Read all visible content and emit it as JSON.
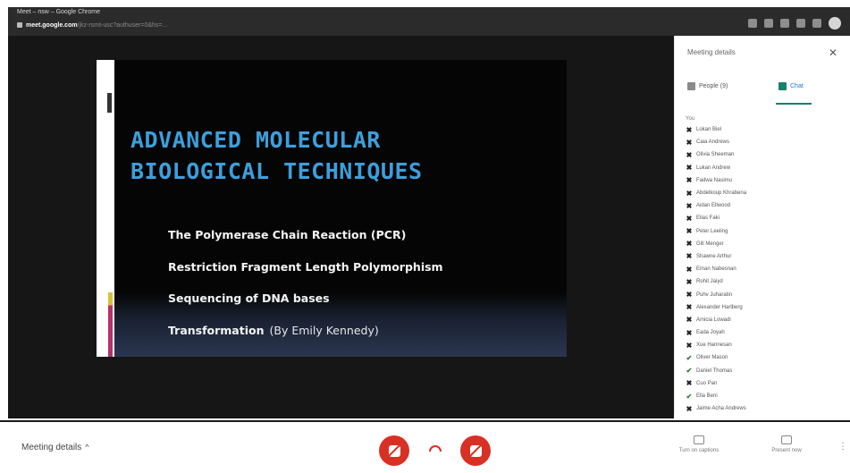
{
  "browser": {
    "title": "Meet – nsw – Google Chrome",
    "url_host": "meet.google.com",
    "url_path": "/jkz-rsmt-usc?authuser=0&hs=..."
  },
  "slide": {
    "title_line1": "ADVANCED MOLECULAR",
    "title_line2": "BIOLOGICAL TECHNIQUES",
    "bullets": [
      "The Polymerase Chain Reaction (PCR)",
      "Restriction Fragment Length Polymorphism",
      "Sequencing of DNA bases",
      "Transformation"
    ],
    "author": "(By Emily Kennedy)",
    "title_color": "#3d9fdc"
  },
  "panel": {
    "title": "Meeting details",
    "tabs": {
      "people": "People (9)",
      "chat": "Chat"
    },
    "sender": "You",
    "chat_messages": [
      {
        "mark": "x",
        "text": "Lokan Biel"
      },
      {
        "mark": "x",
        "text": "Caia Andrews"
      },
      {
        "mark": "x",
        "text": "Olivia Sheeman"
      },
      {
        "mark": "x",
        "text": "Lukan Andrew"
      },
      {
        "mark": "x",
        "text": "Fadwa Nasimu"
      },
      {
        "mark": "x",
        "text": "Abdelkoup Khrabena"
      },
      {
        "mark": "x",
        "text": "Aidan Ellwood"
      },
      {
        "mark": "x",
        "text": "Elias Faki"
      },
      {
        "mark": "x",
        "text": "Peter Leeling"
      },
      {
        "mark": "x",
        "text": "Gill Menger"
      },
      {
        "mark": "x",
        "text": "Shawne Arthur"
      },
      {
        "mark": "x",
        "text": "Eman Nabesnan"
      },
      {
        "mark": "x",
        "text": "Rohit Jaiyd"
      },
      {
        "mark": "x",
        "text": "Puhv Juharatin"
      },
      {
        "mark": "x",
        "text": "Alexander Harlberg"
      },
      {
        "mark": "x",
        "text": "Amicia Lowadi"
      },
      {
        "mark": "x",
        "text": "Eada Joyah"
      },
      {
        "mark": "x",
        "text": "Xue Hannesan"
      },
      {
        "mark": "check",
        "text": "Oliver Mason"
      },
      {
        "mark": "check",
        "text": "Daniel Thomas"
      },
      {
        "mark": "x",
        "text": "Cuo Pan"
      },
      {
        "mark": "check",
        "text": "Ella Beni"
      },
      {
        "mark": "x",
        "text": "Jaime Acha Andrews"
      }
    ]
  },
  "bottom_bar": {
    "meeting_details": "Meeting details",
    "captions": "Turn on captions",
    "present": "Present now",
    "accent_red": "#d93025"
  }
}
